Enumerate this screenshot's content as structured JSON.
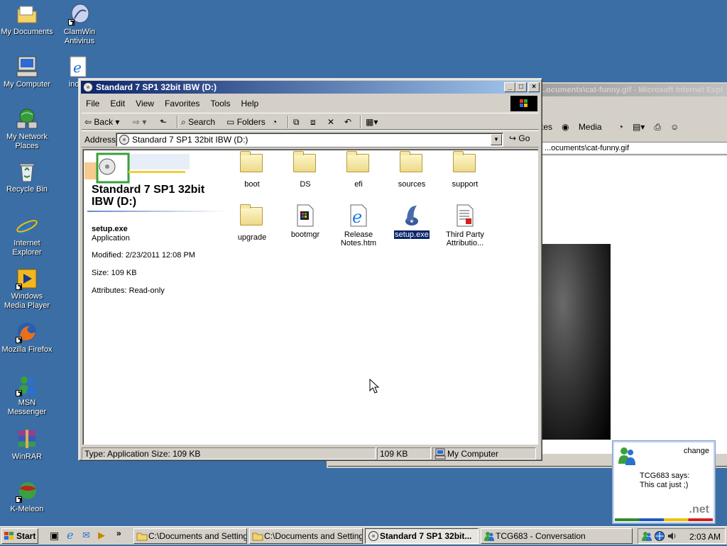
{
  "desktop": {
    "icons": [
      {
        "label": "My Documents"
      },
      {
        "label": "ClamWin Antivirus"
      },
      {
        "label": "My Computer"
      },
      {
        "label": "index"
      },
      {
        "label": "My Network Places"
      },
      {
        "label": "Recycle Bin"
      },
      {
        "label": "Internet Explorer"
      },
      {
        "label": "Windows Media Player"
      },
      {
        "label": "Mozilla Firefox"
      },
      {
        "label": "MSN Messenger"
      },
      {
        "label": "WinRAR"
      },
      {
        "label": "K-Meleon"
      }
    ]
  },
  "ie_window": {
    "title": "...ocuments\\cat-funny.gif - Microsoft Internet Expl",
    "toolbar_partial": "tes",
    "media_label": "Media",
    "address": "...ocuments\\cat-funny.gif"
  },
  "explorer": {
    "title": "Standard 7 SP1 32bit IBW (D:)",
    "menu": [
      "File",
      "Edit",
      "View",
      "Favorites",
      "Tools",
      "Help"
    ],
    "toolbar": {
      "back": "Back",
      "search": "Search",
      "folders": "Folders"
    },
    "address": {
      "label": "Address",
      "value": "Standard 7 SP1 32bit IBW (D:)",
      "go": "Go"
    },
    "side": {
      "title": "Standard 7 SP1 32bit IBW (D:)",
      "file_name": "setup.exe",
      "file_type": "Application",
      "modified": "Modified: 2/23/2011 12:08 PM",
      "size": "Size: 109 KB",
      "attributes": "Attributes: Read-only"
    },
    "files": [
      {
        "name": "boot",
        "kind": "folder"
      },
      {
        "name": "DS",
        "kind": "folder"
      },
      {
        "name": "efi",
        "kind": "folder"
      },
      {
        "name": "sources",
        "kind": "folder"
      },
      {
        "name": "support",
        "kind": "folder"
      },
      {
        "name": "upgrade",
        "kind": "folder"
      },
      {
        "name": "bootmgr",
        "kind": "file"
      },
      {
        "name": "Release Notes.htm",
        "kind": "htm"
      },
      {
        "name": "setup.exe",
        "kind": "exe",
        "selected": true
      },
      {
        "name": "Third Party Attributio...",
        "kind": "doc"
      }
    ],
    "status": {
      "left": "Type: Application Size: 109 KB",
      "size": "109 KB",
      "zone": "My Computer"
    }
  },
  "toast": {
    "change": "change",
    "line1": "TCG683 says:",
    "line2": "This cat just ;)",
    "brand": ".net"
  },
  "taskbar": {
    "start": "Start",
    "tasks": [
      {
        "label": "C:\\Documents and Setting..."
      },
      {
        "label": "C:\\Documents and Setting..."
      },
      {
        "label": "Standard 7 SP1 32bit..."
      },
      {
        "label": "TCG683 - Conversation"
      }
    ],
    "clock": "2:03 AM"
  },
  "colors": {
    "desktop": "#3a6ea5",
    "title_active_start": "#0a246a",
    "title_active_end": "#a6caf0",
    "face": "#d4d0c8",
    "selection": "#0a246a"
  }
}
